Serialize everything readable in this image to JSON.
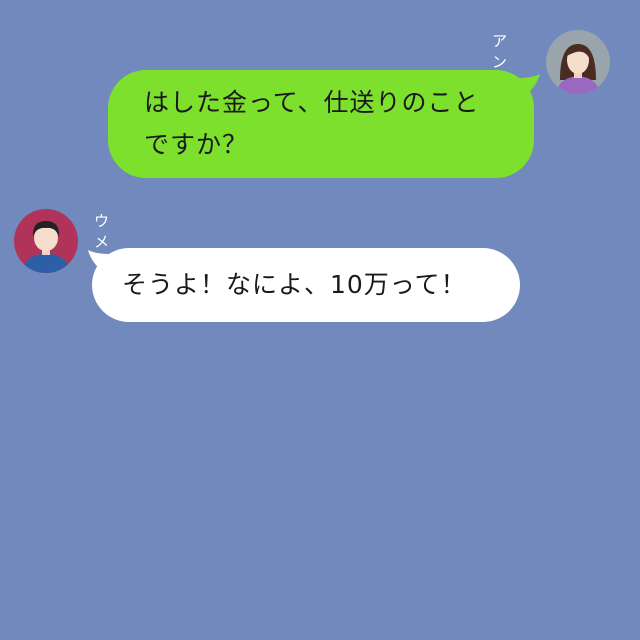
{
  "theme": {
    "background": "#7189bd",
    "outgoing_bubble": "#7de02c",
    "incoming_bubble": "#ffffff"
  },
  "messages": [
    {
      "sender": "アン",
      "side": "right",
      "avatar_icon": "woman-avatar-icon",
      "lines": [
        "はした金って、仕送りのこと",
        "ですか？"
      ]
    },
    {
      "sender": "ウメ",
      "side": "left",
      "avatar_icon": "older-woman-avatar-icon",
      "lines": [
        "そうよ！なによ、10万って！"
      ]
    }
  ]
}
